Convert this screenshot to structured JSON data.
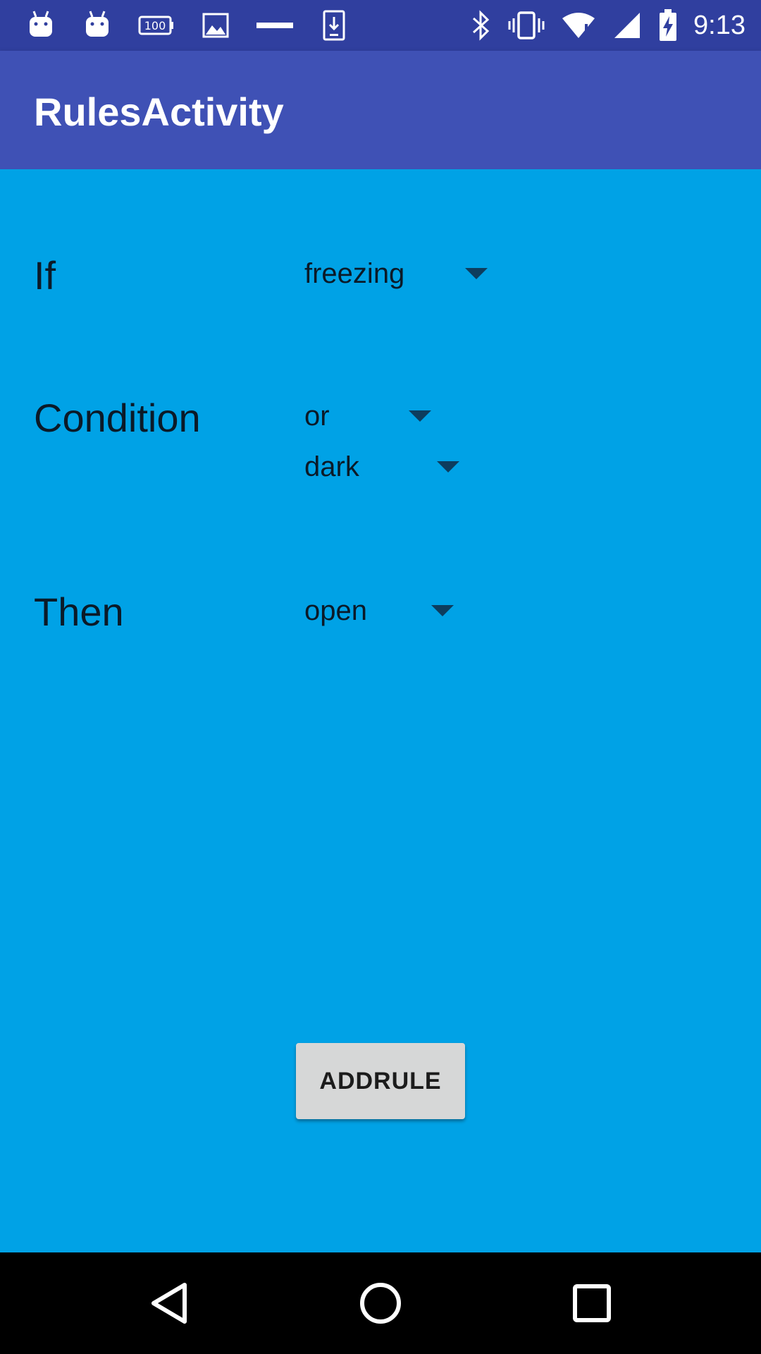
{
  "status_bar": {
    "time": "9:13",
    "left_icons": [
      "android-icon",
      "android-icon",
      "battery-100-icon",
      "image-icon",
      "minus-icon",
      "download-icon"
    ],
    "right_icons": [
      "bluetooth-icon",
      "vibrate-icon",
      "wifi-alert-icon",
      "cell-signal-icon",
      "battery-charging-icon"
    ]
  },
  "app_bar": {
    "title": "RulesActivity"
  },
  "rules": {
    "if_label": "If",
    "if_value": "freezing",
    "condition_label": "Condition",
    "condition_operator": "or",
    "condition_value": "dark",
    "then_label": "Then",
    "then_value": "open"
  },
  "add_button_label": "ADDRULE",
  "nav_bar": {
    "icons": [
      "back-icon",
      "home-icon",
      "recents-icon"
    ]
  },
  "colors": {
    "status_bar": "#303F9F",
    "app_bar": "#3F51B5",
    "background": "#00A2E6",
    "button": "#D6D7D7"
  }
}
